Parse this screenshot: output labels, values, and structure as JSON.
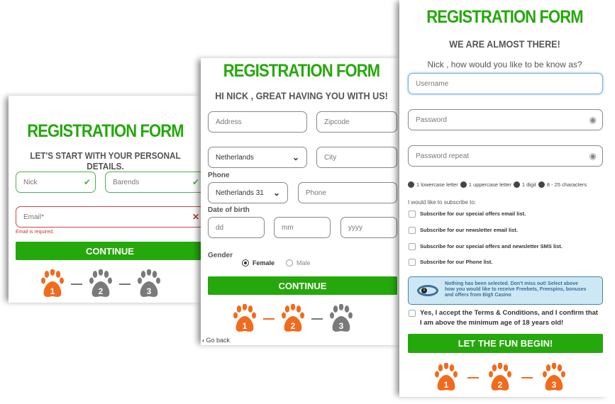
{
  "colors": {
    "green": "#25a80b",
    "orange": "#f26a1b",
    "gray": "#7a7a7a",
    "error": "#c0392b"
  },
  "step1": {
    "title": "REGISTRATION FORM",
    "subtitle": "LET'S START WITH YOUR PERSONAL DETAILS.",
    "first_name": "Nick",
    "last_name": "Barends",
    "email_placeholder": "Email*",
    "email_error": "Email is required.",
    "continue": "CONTINUE",
    "steps": [
      "1",
      "2",
      "3"
    ]
  },
  "step2": {
    "title": "REGISTRATION FORM",
    "subtitle": "HI NICK , GREAT HAVING YOU WITH US!",
    "address_placeholder": "Address",
    "zipcode_placeholder": "Zipcode",
    "country": "Netherlands",
    "city_placeholder": "City",
    "phone_label": "Phone",
    "phone_code": "Netherlands 31",
    "phone_placeholder": "Phone",
    "dob_label": "Date of birth",
    "dd": "dd",
    "mm": "mm",
    "yyyy": "yyyy",
    "gender_label": "Gender",
    "female": "Female",
    "male": "Male",
    "gender_selected": "Female",
    "continue": "CONTINUE",
    "go_back": "Go back",
    "steps": [
      "1",
      "2",
      "3"
    ]
  },
  "step3": {
    "title": "REGISTRATION FORM",
    "subtitle": "WE ARE ALMOST THERE!",
    "prompt": "Nick , how would you like to be know as?",
    "username_placeholder": "Username",
    "password_placeholder": "Password",
    "password_repeat_placeholder": "Password repeat",
    "rules": [
      "1 lowercase letter",
      "1 uppercase letter",
      "1 digit",
      "8 - 25 characters"
    ],
    "subscribe_label": "I would like to subscribe to:",
    "subscriptions": [
      "Subscribe for our special offers email list.",
      "Subscribe for our newsletter email list.",
      "Subscribe for our special offers and newsletter SMS list.",
      "Subscribe for our Phone list."
    ],
    "notice": "Nothing has been selected. Don't miss out! Select above how you would like to receive Freebets, Freespins, bonuses and offers from Big5 Casino",
    "terms": "Yes, I accept the Terms & Conditions, and I confirm that I am above the minimum age of 18 years old!",
    "submit": "LET THE FUN BEGIN!",
    "steps": [
      "1",
      "2",
      "3"
    ]
  }
}
